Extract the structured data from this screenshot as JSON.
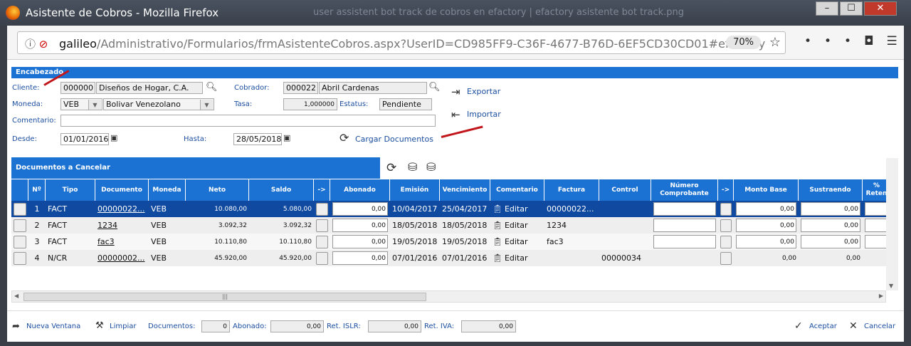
{
  "window": {
    "title": "Asistente de Cobros - Mozilla Firefox",
    "background_tabs": "user assistent bot track de cobros en efactory  |  efactory asistente bot track.png"
  },
  "browser": {
    "url_host": "galileo",
    "url_path": "/Administrativo/Formularios/frmAsistenteCobros.aspx?UserID=CD985FF9-C36F-4677-B76D-6EF5CD30CD01#efactory",
    "zoom": "70%"
  },
  "encabezado": {
    "title": "Encabezado",
    "cliente_label": "Cliente:",
    "cliente_code": "000000",
    "cliente_name": "Diseños de Hogar, C.A.",
    "cobrador_label": "Cobrador:",
    "cobrador_code": "000022",
    "cobrador_name": "Abril Cardenas",
    "moneda_label": "Moneda:",
    "moneda_code": "VEB",
    "moneda_name": "Bolivar Venezolano",
    "tasa_label": "Tasa:",
    "tasa": "1,000000",
    "estatus_label": "Estatus:",
    "estatus": "Pendiente",
    "comentario_label": "Comentario:",
    "comentario": "",
    "desde_label": "Desde:",
    "desde": "01/01/2016",
    "hasta_label": "Hasta:",
    "hasta": "28/05/2018",
    "cargar": "Cargar Documentos",
    "exportar": "Exportar",
    "importar": "Importar"
  },
  "documentos": {
    "title": "Documentos a Cancelar",
    "columns": [
      "",
      "Nº",
      "Tipo",
      "Documento",
      "Moneda",
      "Neto",
      "Saldo",
      "->",
      "Abonado",
      "Emisión",
      "Vencimiento",
      "Comentario",
      "Factura",
      "Control",
      "Número Comprobante",
      "->",
      "Monto Base",
      "Sustraendo",
      "% Reten"
    ],
    "rows": [
      {
        "n": "1",
        "tipo": "FACT",
        "documento": "00000022...",
        "moneda": "VEB",
        "neto": "10.080,00",
        "saldo": "5.080,00",
        "abonado": "0,00",
        "emision": "10/04/2017",
        "vencimiento": "25/04/2017",
        "comentario": "Editar",
        "factura": "00000022...",
        "control": "",
        "monto_base": "0,00",
        "sustraendo": "0,00",
        "selected": true,
        "editable": true
      },
      {
        "n": "2",
        "tipo": "FACT",
        "documento": "1234",
        "moneda": "VEB",
        "neto": "3.092,32",
        "saldo": "3.092,32",
        "abonado": "0,00",
        "emision": "18/05/2018",
        "vencimiento": "18/05/2018",
        "comentario": "Editar",
        "factura": "1234",
        "control": "",
        "monto_base": "0,00",
        "sustraendo": "0,00",
        "selected": false,
        "editable": true
      },
      {
        "n": "3",
        "tipo": "FACT",
        "documento": "fac3",
        "moneda": "VEB",
        "neto": "10.110,80",
        "saldo": "10.110,80",
        "abonado": "0,00",
        "emision": "19/05/2018",
        "vencimiento": "19/05/2018",
        "comentario": "Editar",
        "factura": "fac3",
        "control": "",
        "monto_base": "0,00",
        "sustraendo": "0,00",
        "selected": false,
        "editable": true
      },
      {
        "n": "4",
        "tipo": "N/CR",
        "documento": "00000002...",
        "moneda": "VEB",
        "neto": "45.920,00",
        "saldo": "45.920,00",
        "abonado": "0,00",
        "emision": "07/01/2016",
        "vencimiento": "07/01/2016",
        "comentario": "Editar",
        "factura": "",
        "control": "00000034",
        "monto_base": "0,00",
        "sustraendo": "0,00",
        "selected": false,
        "editable": false
      }
    ]
  },
  "footer": {
    "nueva_ventana": "Nueva Ventana",
    "limpiar": "Limpiar",
    "documentos_label": "Documentos:",
    "documentos": "0",
    "abonado_label": "Abonado:",
    "abonado": "0,00",
    "islr_label": "Ret. ISLR:",
    "islr": "0,00",
    "iva_label": "Ret. IVA:",
    "iva": "0,00",
    "aceptar": "Aceptar",
    "cancelar": "Cancelar"
  },
  "colors": {
    "header_blue": "#1c72d2",
    "selected_row": "#0f4aa0",
    "label_blue": "#1c4fa0",
    "annotation_arrow": "#c0161c"
  }
}
